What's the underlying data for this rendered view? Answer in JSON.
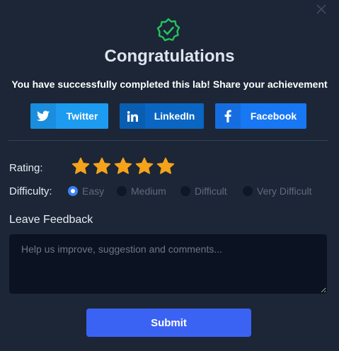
{
  "dialog": {
    "title": "Congratulations",
    "message": "You have successfully completed this lab! Share your achievement"
  },
  "share": [
    {
      "label": "Twitter",
      "icon": "twitter-icon",
      "color": "#1d9bf0"
    },
    {
      "label": "LinkedIn",
      "icon": "linkedin-icon",
      "color": "#0a66c2"
    },
    {
      "label": "Facebook",
      "icon": "facebook-icon",
      "color": "#1877f2"
    }
  ],
  "rating": {
    "label": "Rating:",
    "value": 5,
    "max": 5,
    "star_color": "#f5a31a"
  },
  "difficulty": {
    "label": "Difficulty:",
    "options": [
      "Easy",
      "Medium",
      "Difficult",
      "Very Difficult"
    ],
    "selected": "Easy"
  },
  "feedback": {
    "label": "Leave Feedback",
    "placeholder": "Help us improve, suggestion and comments...",
    "value": ""
  },
  "submit_label": "Submit",
  "colors": {
    "background": "#1c2637",
    "success": "#22c55e",
    "primary": "#3b63f3"
  }
}
